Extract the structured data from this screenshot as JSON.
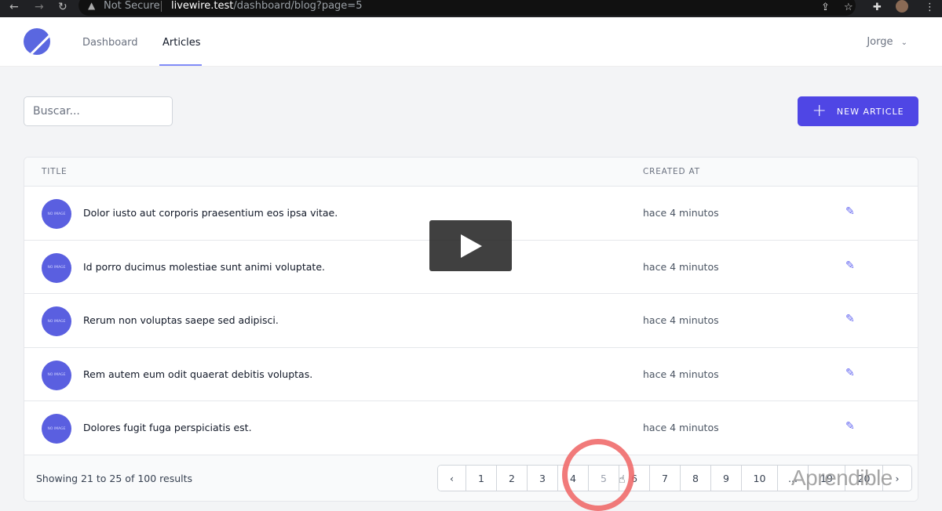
{
  "browser": {
    "security": "Not Secure",
    "url_host": "livewire.test",
    "url_path": "/dashboard/blog?page=5"
  },
  "nav": {
    "items": [
      {
        "label": "Dashboard"
      },
      {
        "label": "Articles"
      }
    ],
    "user": "Jorge"
  },
  "toolbar": {
    "search_placeholder": "Buscar...",
    "new_article": "NEW ARTICLE"
  },
  "table": {
    "headers": {
      "title": "TITLE",
      "created_at": "CREATED AT"
    },
    "thumb_text": "NO IMAGE",
    "rows": [
      {
        "title": "Dolor iusto aut corporis praesentium eos ipsa vitae.",
        "created": "hace 4 minutos"
      },
      {
        "title": "Id porro ducimus molestiae sunt animi voluptate.",
        "created": "hace 4 minutos"
      },
      {
        "title": "Rerum non voluptas saepe sed adipisci.",
        "created": "hace 4 minutos"
      },
      {
        "title": "Rem autem eum odit quaerat debitis voluptas.",
        "created": "hace 4 minutos"
      },
      {
        "title": "Dolores fugit fuga perspiciatis est.",
        "created": "hace 4 minutos"
      }
    ]
  },
  "pagination": {
    "summary": "Showing 21 to 25 of 100 results",
    "current": "5",
    "pages": [
      "1",
      "2",
      "3",
      "4",
      "5",
      "6",
      "7",
      "8",
      "9",
      "10",
      "...",
      "19",
      "20"
    ]
  },
  "watermark": "Aprendible",
  "colors": {
    "accent": "#4f46e5"
  }
}
